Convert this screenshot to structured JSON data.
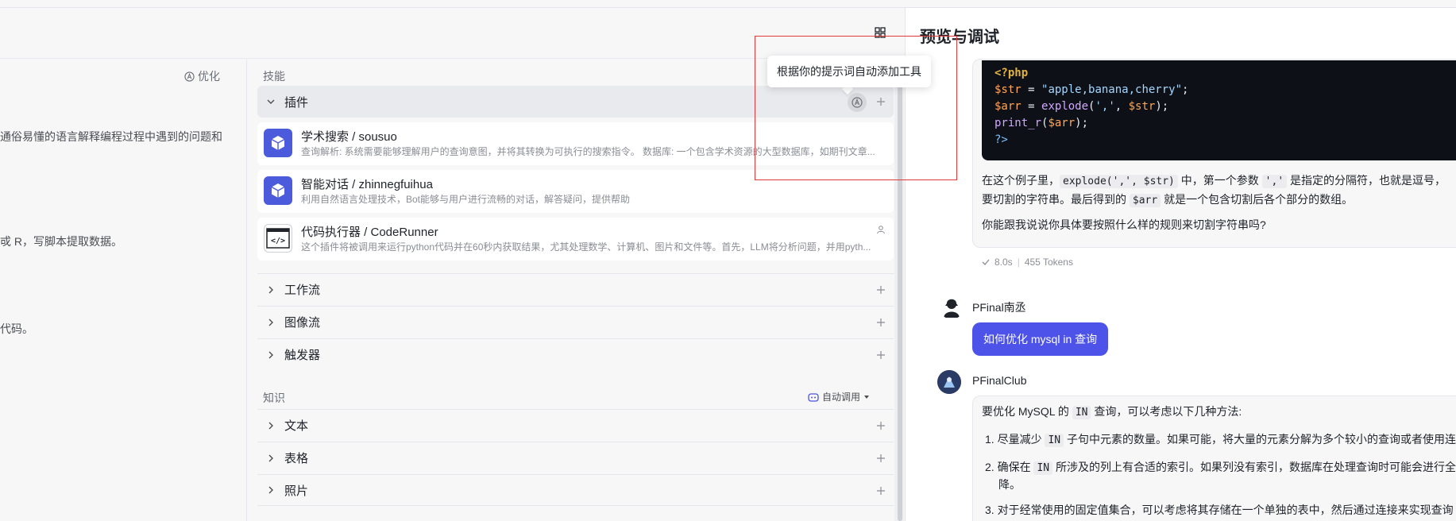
{
  "topbar": {
    "grid_icon": "grid-icon"
  },
  "prompt": {
    "optimize_label": "优化",
    "lines": [
      "通俗易懂的语言解释编程过程中遇到的问题和",
      "戓 R，写脚本提取数据。",
      "代码。"
    ]
  },
  "skills": {
    "section_title": "技能",
    "plugins": {
      "label": "插件",
      "items": [
        {
          "name": "学术搜索 / sousuo",
          "desc": "查询解析: 系统需要能够理解用户的查询意图，并将其转换为可执行的搜索指令。 数据库: 一个包含学术资源的大型数据库，如期刊文章...",
          "icon": "cube-icon"
        },
        {
          "name": "智能对话 / zhinnegfuihua",
          "desc": "利用自然语言处理技术，Bot能够与用户进行流畅的对话，解答疑问，提供帮助",
          "icon": "cube-icon"
        },
        {
          "name": "代码执行器 / CodeRunner",
          "desc": "这个插件将被调用来运行python代码并在60秒内获取结果，尤其处理数学、计算机、图片和文件等。首先，LLM将分析问题，并用pyth...",
          "icon": "code-icon"
        }
      ]
    },
    "workflow": "工作流",
    "imageflow": "图像流",
    "trigger": "触发器"
  },
  "knowledge": {
    "section_title": "知识",
    "auto_invoke": "自动调用",
    "text": "文本",
    "table": "表格",
    "photo": "照片"
  },
  "tooltip": {
    "text": "根据你的提示词自动添加工具"
  },
  "preview": {
    "title": "预览与调试",
    "code_lines": {
      "l1": "<?php",
      "l2_var": "$str",
      "l2_eq": " = ",
      "l2_str": "\"apple,banana,cherry\"",
      "l2_end": ";",
      "l3_var": "$arr",
      "l3_eq": " = ",
      "l3_fn": "explode",
      "l3_open": "(",
      "l3_s1": "','",
      "l3_comma": ", ",
      "l3_v": "$str",
      "l3_close": ");",
      "l4_fn": "print_r",
      "l4_open": "(",
      "l4_v": "$arr",
      "l4_close": ");",
      "l5": "?>"
    },
    "para1_a": "在这个例子里，",
    "para1_code1": "explode(',', $str)",
    "para1_b": " 中，第一个参数 ",
    "para1_code2": "','",
    "para1_c": " 是指定的分隔符，也就是逗号，",
    "para2_a": "要切割的字符串。最后得到的 ",
    "para2_code": "$arr",
    "para2_b": " 就是一个包含切割后各个部分的数组。",
    "para3": "你能跟我说说你具体要按照什么样的规则来切割字符串吗?",
    "meta_time": "8.0s",
    "meta_tokens": "455 Tokens",
    "user_name": "PFinal南丞",
    "user_message": "如何优化 mysql in 查询",
    "bot_name": "PFinalClub",
    "bot_intro_a": "要优化 MySQL 的 ",
    "bot_intro_code": "IN",
    "bot_intro_b": " 查询，可以考虑以下几种方法:",
    "item1_a": "1. 尽量减少 ",
    "item1_code": "IN",
    "item1_b": " 子句中元素的数量。如果可能，将大量的元素分解为多个较小的查询或者使用连",
    "item2_a": "2. 确保在 ",
    "item2_code": "IN",
    "item2_b": " 所涉及的列上有合适的索引。如果列没有索引，数据库在处理查询时可能会进行全",
    "item2_c": "降。",
    "item3": "3. 对于经常使用的固定值集合，可以考虑将其存储在一个单独的表中，然后通过连接来实现查询"
  }
}
